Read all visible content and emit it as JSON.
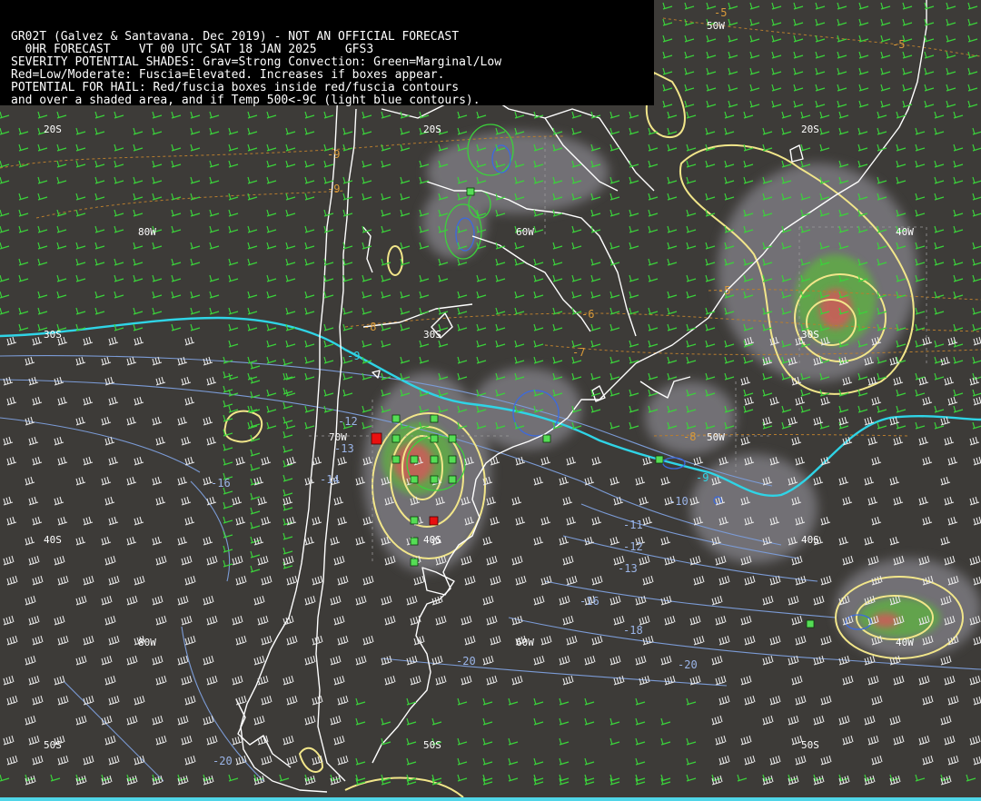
{
  "header": {
    "lines": [
      "GR02T (Galvez & Santavana. Dec 2019) - NOT AN OFFICIAL FORECAST",
      "  0HR FORECAST    VT 00 UTC SAT 18 JAN 2025    GFS3",
      "SEVERITY POTENTIAL SHADES: Grav=Strong Convection: Green=Marginal/Low",
      "Red=Low/Moderate: Fuscia=Elevated. Increases if boxes appear.",
      "POTENTIAL FOR HAIL: Red/fuscia boxes inside red/fuscia contours",
      "and over a shaded area, and if Temp 500<-9C (light blue contours)."
    ]
  },
  "grid_labels": {
    "lat": [
      "20S",
      "20S",
      "20S",
      "30S",
      "30S",
      "30S",
      "40S",
      "40S",
      "40S",
      "50S",
      "50S",
      "50S"
    ],
    "lon": [
      "50W",
      "80W",
      "60W",
      "40W",
      "70W",
      "50W",
      "80W",
      "60W",
      "40W"
    ]
  },
  "temp_labels": {
    "orange": [
      "-5",
      "-5",
      "-5",
      "-9",
      "-9",
      "-8",
      "-6",
      "-7",
      "-8"
    ],
    "blue": [
      "-9",
      "-9",
      "-12",
      "-13",
      "-14",
      "-16",
      "-10",
      "-11",
      "-12",
      "-13",
      "-16",
      "-18",
      "-20",
      "-20",
      "-20"
    ]
  },
  "colors": {
    "background": "#3d3b38",
    "coast": "#ffffff",
    "strong_convection": "#7a7a80",
    "marginal": "#5fb043",
    "low_moderate": "#d05a5a",
    "severity_contour": "#f2e68a",
    "isotherm_minus9": "#2fd4e6",
    "isotherm": "#7b9bd6",
    "isotherm_warm": "#b87d2e",
    "wind_barb_green": "#3bd23b",
    "wind_barb_white": "#e8e8e8",
    "box_green": "#55dd55",
    "box_red": "#e81010"
  },
  "boxes": {
    "green_count": 22,
    "red_count": 2
  }
}
